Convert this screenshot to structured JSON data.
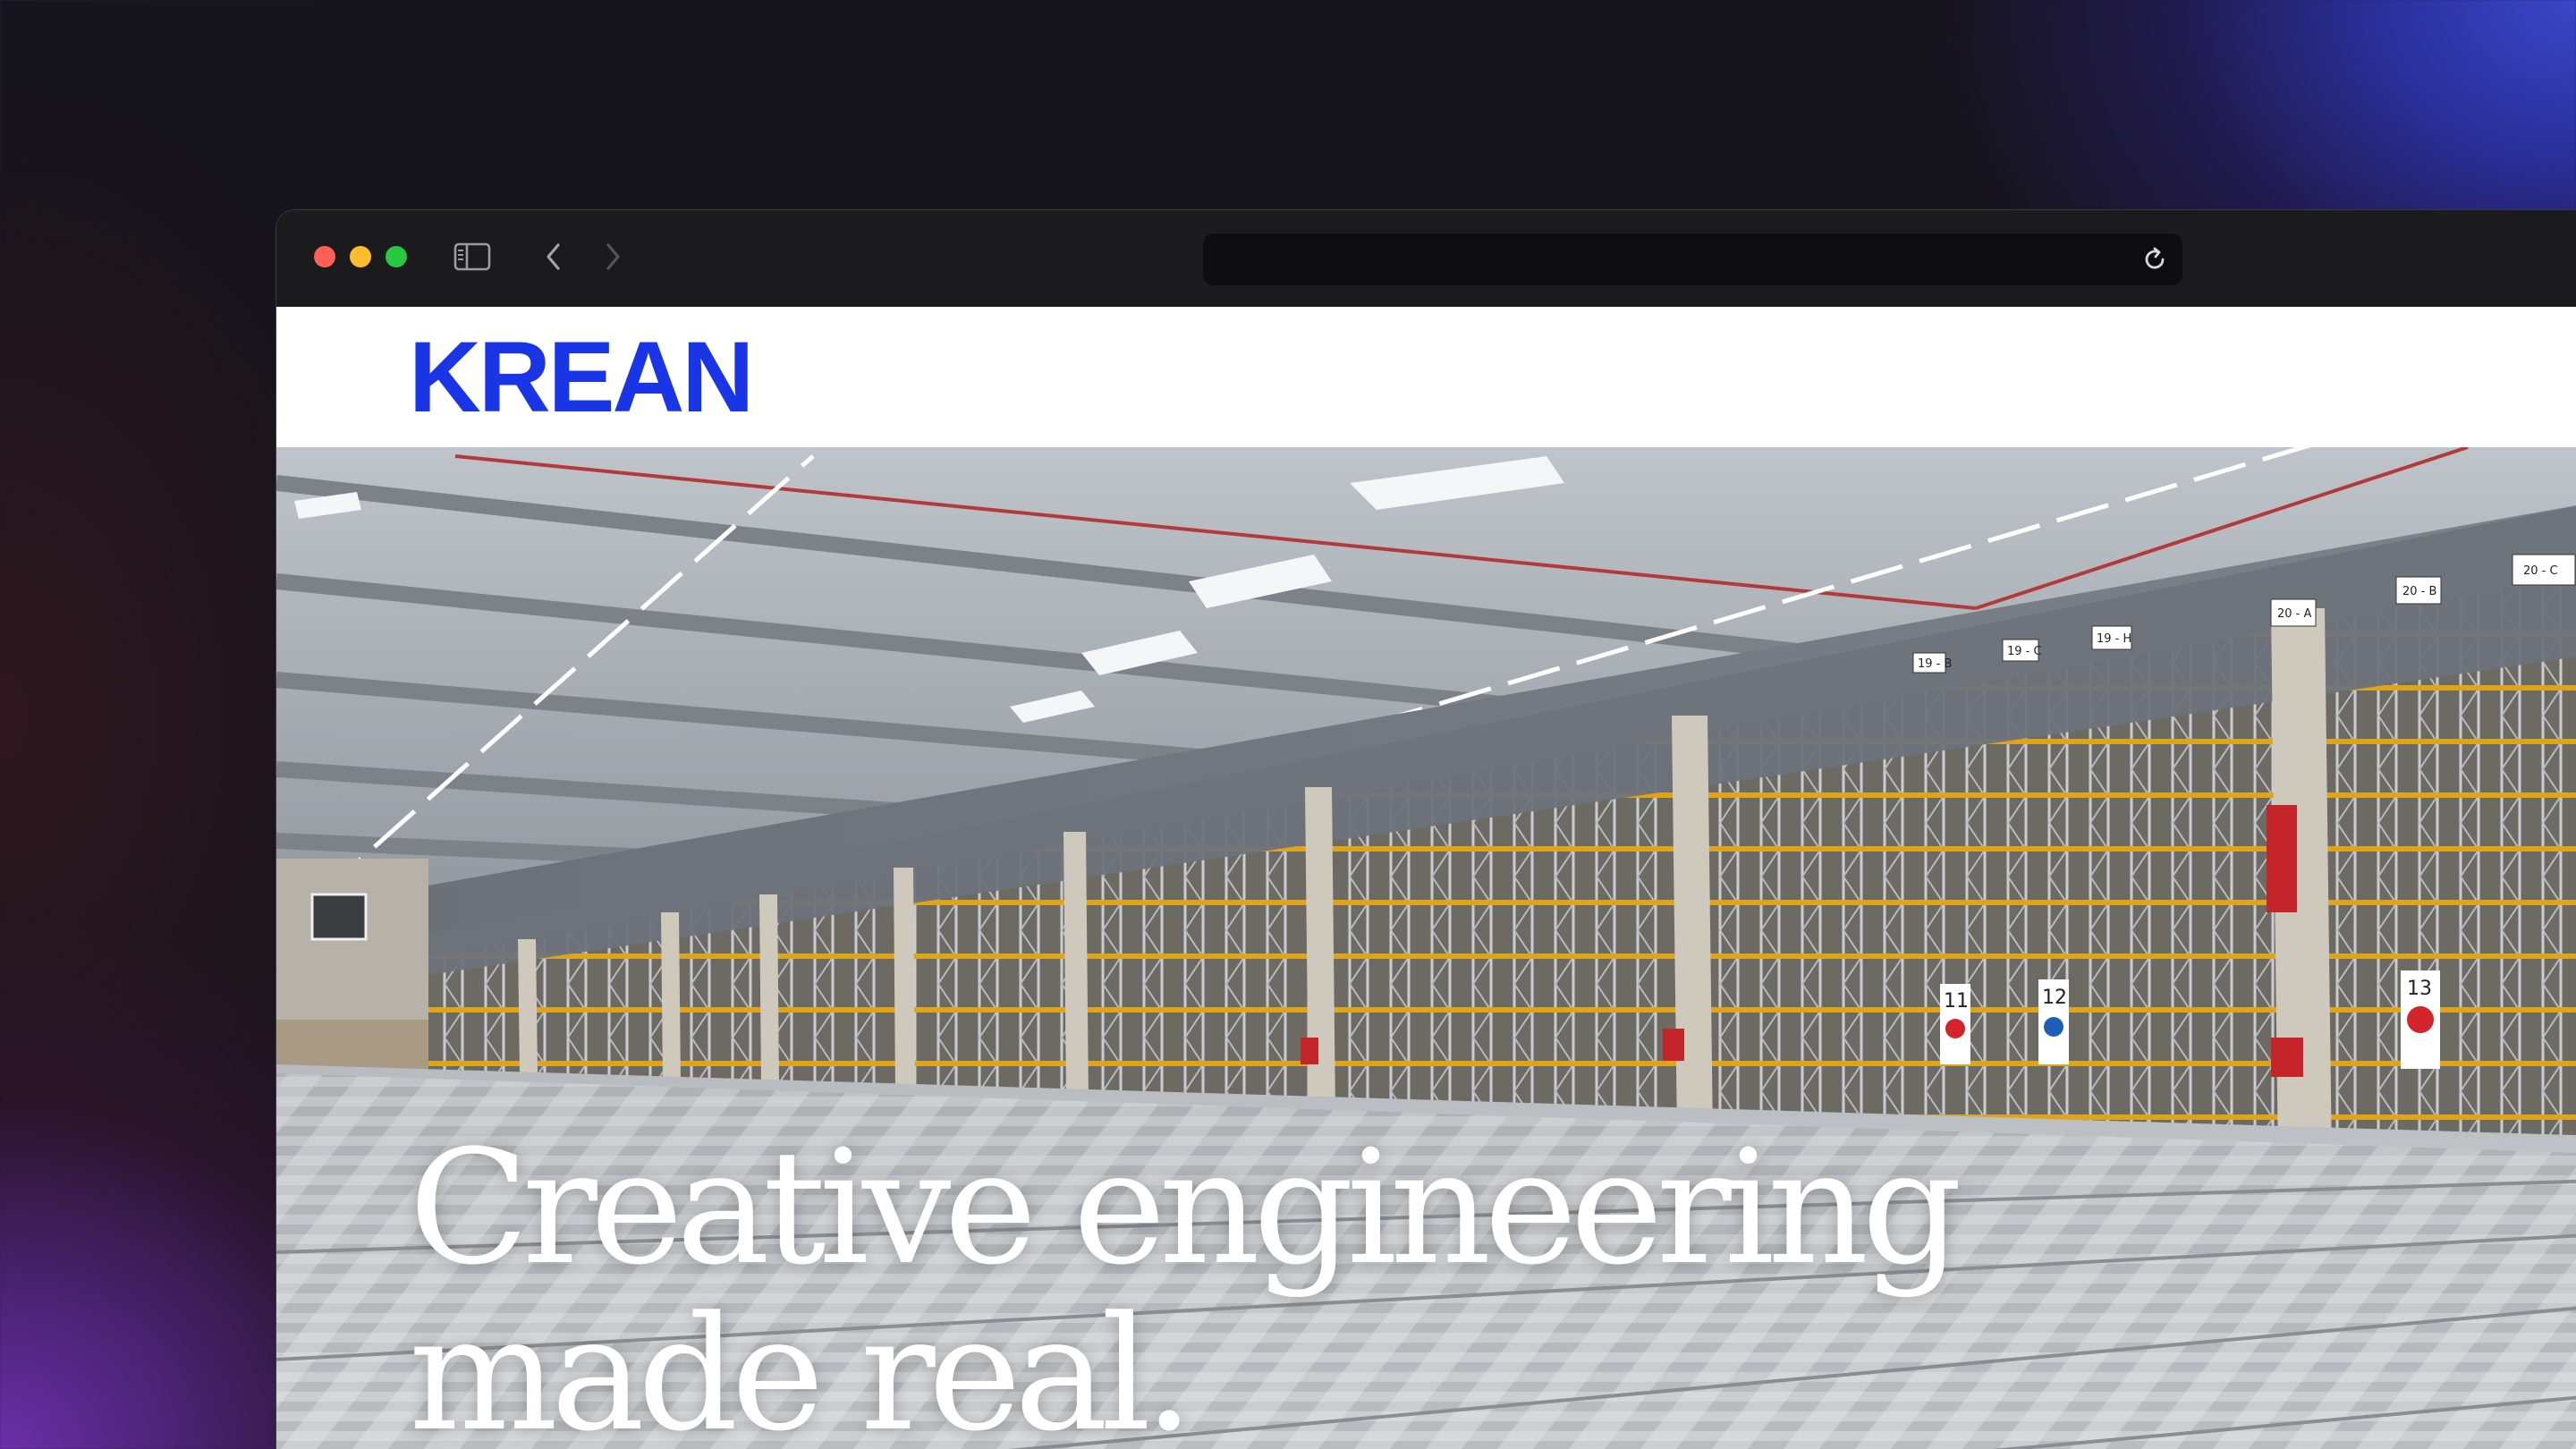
{
  "browser": {
    "url": "",
    "traffic_lights": [
      "close",
      "minimize",
      "zoom"
    ],
    "icons": [
      "sidebar-icon",
      "back-icon",
      "forward-icon",
      "shield-icon",
      "reload-icon"
    ]
  },
  "site": {
    "logo": "KREAN",
    "brand_color": "#1a35e6"
  },
  "hero": {
    "title_line1": "Creative engineering",
    "title_line2": "made real.",
    "image": "warehouse-racking-photo",
    "aisle_signs": [
      "20 - A",
      "20 - B",
      "20 - C",
      "19 - B",
      "19 - C",
      "19 - H"
    ],
    "door_numbers": [
      "11",
      "12",
      "13"
    ]
  }
}
